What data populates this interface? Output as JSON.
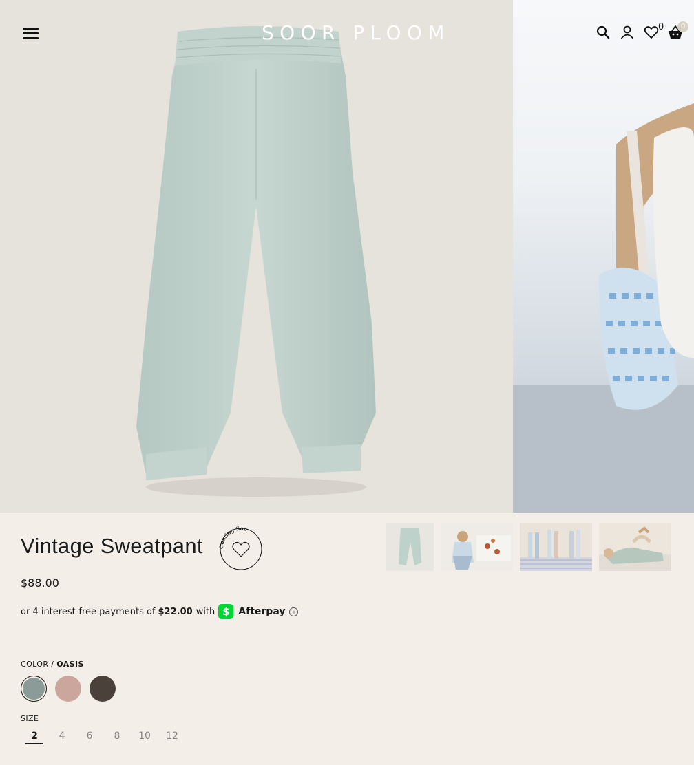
{
  "header": {
    "logo": "SOOR PLOOM",
    "wishlist_count": "0",
    "cart_count": "0"
  },
  "product": {
    "title": "Vintage Sweatpant",
    "coming_soon": "Coming Soon",
    "price": "$88.00",
    "afterpay": {
      "prefix": "or 4 interest-free payments of",
      "installment": "$22.00",
      "with": "with",
      "cash_symbol": "$",
      "brand": "Afterpay",
      "info": "i"
    },
    "color": {
      "label": "COLOR /",
      "selected": "OASIS",
      "swatches": [
        "#8b9b98",
        "#cba69d",
        "#4a413a"
      ]
    },
    "size": {
      "label": "SIZE",
      "options": [
        "2",
        "4",
        "6",
        "8",
        "10",
        "12"
      ],
      "selected": "2"
    }
  }
}
